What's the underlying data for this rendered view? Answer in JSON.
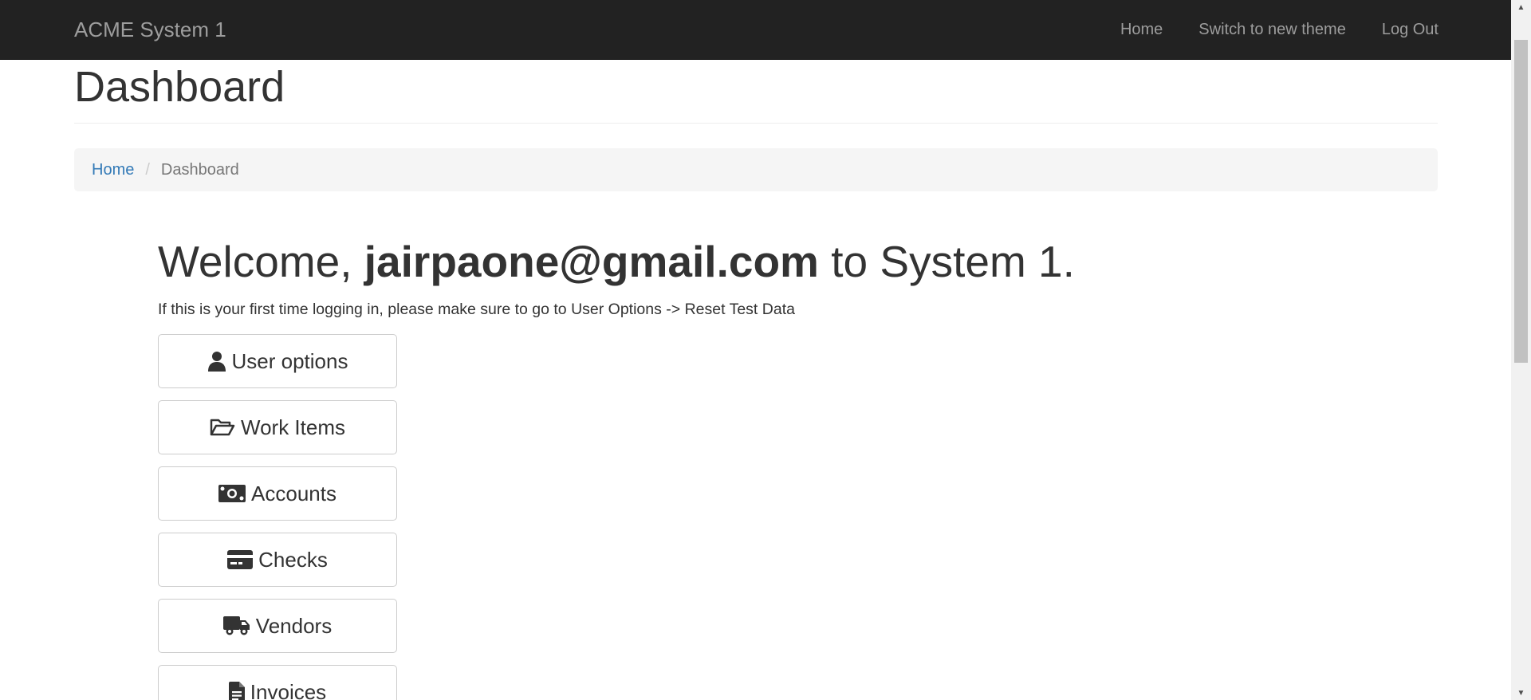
{
  "navbar": {
    "brand": "ACME System 1",
    "links": [
      {
        "label": "Home"
      },
      {
        "label": "Switch to new theme"
      },
      {
        "label": "Log Out"
      }
    ]
  },
  "page": {
    "title": "Dashboard"
  },
  "breadcrumb": {
    "items": [
      {
        "label": "Home",
        "link": true
      },
      {
        "label": "Dashboard",
        "link": false
      }
    ]
  },
  "welcome": {
    "prefix": "Welcome, ",
    "user": "jairpaone@gmail.com",
    "suffix": " to System 1.",
    "note": "If this is your first time logging in, please make sure to go to User Options -> Reset Test Data"
  },
  "menu": {
    "buttons": [
      {
        "label": "User options",
        "icon": "user-icon"
      },
      {
        "label": "Work Items",
        "icon": "folder-open-icon"
      },
      {
        "label": "Accounts",
        "icon": "money-bill-icon"
      },
      {
        "label": "Checks",
        "icon": "credit-card-icon"
      },
      {
        "label": "Vendors",
        "icon": "truck-icon"
      },
      {
        "label": "Invoices",
        "icon": "file-invoice-icon"
      }
    ]
  },
  "colors": {
    "navbar_bg": "#222222",
    "navbar_text": "#9d9d9d",
    "link": "#337ab7",
    "breadcrumb_bg": "#f5f5f5",
    "text": "#333333"
  }
}
